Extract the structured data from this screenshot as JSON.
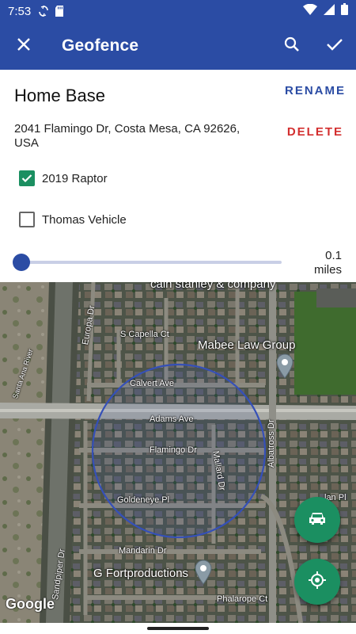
{
  "status_bar": {
    "time": "7:53",
    "icons": [
      "sync-icon",
      "sd-card-icon",
      "wifi-icon",
      "signal-icon",
      "battery-icon"
    ]
  },
  "app_bar": {
    "title": "Geofence",
    "close_icon": "close-icon",
    "search_icon": "search-icon",
    "confirm_icon": "check-icon"
  },
  "geofence": {
    "name": "Home Base",
    "rename_label": "RENAME",
    "address": "2041 Flamingo Dr, Costa Mesa, CA 92626, USA",
    "delete_label": "DELETE",
    "vehicles": [
      {
        "label": "2019 Raptor",
        "checked": true
      },
      {
        "label": "Thomas Vehicle",
        "checked": false
      }
    ],
    "radius": {
      "value": "0.1",
      "unit": "miles",
      "slider_fraction": 0.0
    }
  },
  "map": {
    "street_labels": {
      "s_capella": "S Capella Ct",
      "europa": "Europa Dr",
      "calvert": "Calvert Ave",
      "adams": "Adams Ave",
      "flamingo": "Flamingo Dr",
      "mallard": "Mallard Dr",
      "goldeneye": "Goldeneye Pl",
      "albatross": "Albatross Dr",
      "mandarin": "Mandarin Dr",
      "sandpiper": "Sandpiper Dr",
      "phalarope": "Phalarope Ct",
      "santa_ana": "Santa Ana River",
      "lan_pl": "lan Pl"
    },
    "places": {
      "top": "cain stanley & company",
      "mabee": "Mabee Law Group",
      "fortproductions": "G Fortproductions"
    },
    "attribution": "Google",
    "colors": {
      "fence": "#3550b8",
      "fab": "#1b8f61",
      "accent": "#2b4ca4",
      "delete": "#d32f2f"
    }
  },
  "fabs": {
    "car_icon": "car-icon",
    "locate_icon": "my-location-icon"
  }
}
